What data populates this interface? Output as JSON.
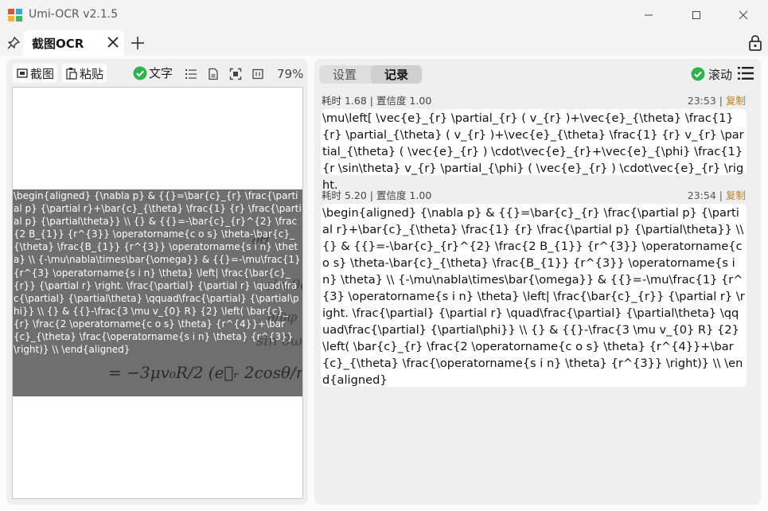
{
  "window": {
    "title": "Umi-OCR v2.1.5"
  },
  "tabs": [
    {
      "label": "截图OCR"
    }
  ],
  "left_toolbar": {
    "screenshot_label": "截图",
    "paste_label": "粘贴",
    "text_label": "文字",
    "zoom": "79%"
  },
  "preview": {
    "overlay_text": "\\begin{aligned} {\\nabla p} & {{}=\\bar{c}_{r} \\frac{\\partial p} {\\partial r}+\\bar{c}_{\\theta} \\frac{1} {r} \\frac{\\partial p} {\\partial\\theta}} \\\\ {} & {{}=-\\bar{c}_{r}^{2} \\frac{2 B_{1}} {r^{3}} \\operatorname{c o s} \\theta-\\bar{c}_{\\theta} \\frac{B_{1}} {r^{3}} \\operatorname{s i n} \\theta} \\\\ {-\\mu\\nabla\\times\\bar{\\omega}} & {{}=-\\mu\\frac{1} {r^{3} \\operatorname{s i n} \\theta} \\left| \\frac{\\bar{c}_{r}} {\\partial r} \\right. \\frac{\\partial} {\\partial r} \\quad\\frac{\\partial} {\\partial\\theta} \\qquad\\frac{\\partial} {\\partial\\phi}} \\\\ {} & {{}-\\frac{3 \\mu v_{0} R} {2} \\left( \\bar{c}_{r} \\frac{2 \\operatorname{c o s} \\theta} {r^{4}}+\\bar{c}_{\\theta} \\frac{\\operatorname{s i n} \\theta} {r^{3}} \\right)} \\\\ \\end{aligned}"
  },
  "right_panel": {
    "tab_settings": "设置",
    "tab_records": "记录",
    "scroll_label": "滚动"
  },
  "records": [
    {
      "meta": "耗时 1.68 | 置信度 1.00",
      "time": "23:53",
      "copy_label": "复制",
      "text": "\\mu\\left[ \\vec{e}_{r} \\partial_{r} ( v_{r} )+\\vec{e}_{\\theta} \\frac{1} {r} \\partial_{\\theta} ( v_{r} )+\\vec{e}_{\\theta} \\frac{1} {r} v_{r} \\partial_{\\theta} ( \\vec{e}_{r} ) \\cdot\\vec{e}_{r}+\\vec{e}_{\\phi} \\frac{1} {r \\sin\\theta} v_{r} \\partial_{\\phi} ( \\vec{e}_{r} ) \\cdot\\vec{e}_{r} \\right."
    },
    {
      "meta": "耗时 5.20 | 置信度 1.00",
      "time": "23:54",
      "copy_label": "复制",
      "text": "\\begin{aligned} {\\nabla p} & {{}=\\bar{c}_{r} \\frac{\\partial p} {\\partial r}+\\bar{c}_{\\theta} \\frac{1} {r} \\frac{\\partial p} {\\partial\\theta}} \\\\ {} & {{}=-\\bar{c}_{r}^{2} \\frac{2 B_{1}} {r^{3}} \\operatorname{c o s} \\theta-\\bar{c}_{\\theta} \\frac{B_{1}} {r^{3}} \\operatorname{s i n} \\theta} \\\\ {-\\mu\\nabla\\times\\bar{\\omega}} & {{}=-\\mu\\frac{1} {r^{3} \\operatorname{s i n} \\theta} \\left| \\frac{\\bar{c}_{r}} {\\partial r} \\right. \\frac{\\partial} {\\partial r} \\quad\\frac{\\partial} {\\partial\\theta} \\qquad\\frac{\\partial} {\\partial\\phi}} \\\\ {} & {{}-\\frac{3 \\mu v_{0} R} {2} \\left( \\bar{c}_{r} \\frac{2 \\operatorname{c o s} \\theta} {r^{4}}+\\bar{c}_{\\theta} \\frac{\\operatorname{s i n} \\theta} {r^{3}} \\right)} \\\\ \\end{aligned}"
    }
  ],
  "colors": {
    "accent_green": "#2fb34a",
    "copy_orange": "#c87a1a"
  }
}
